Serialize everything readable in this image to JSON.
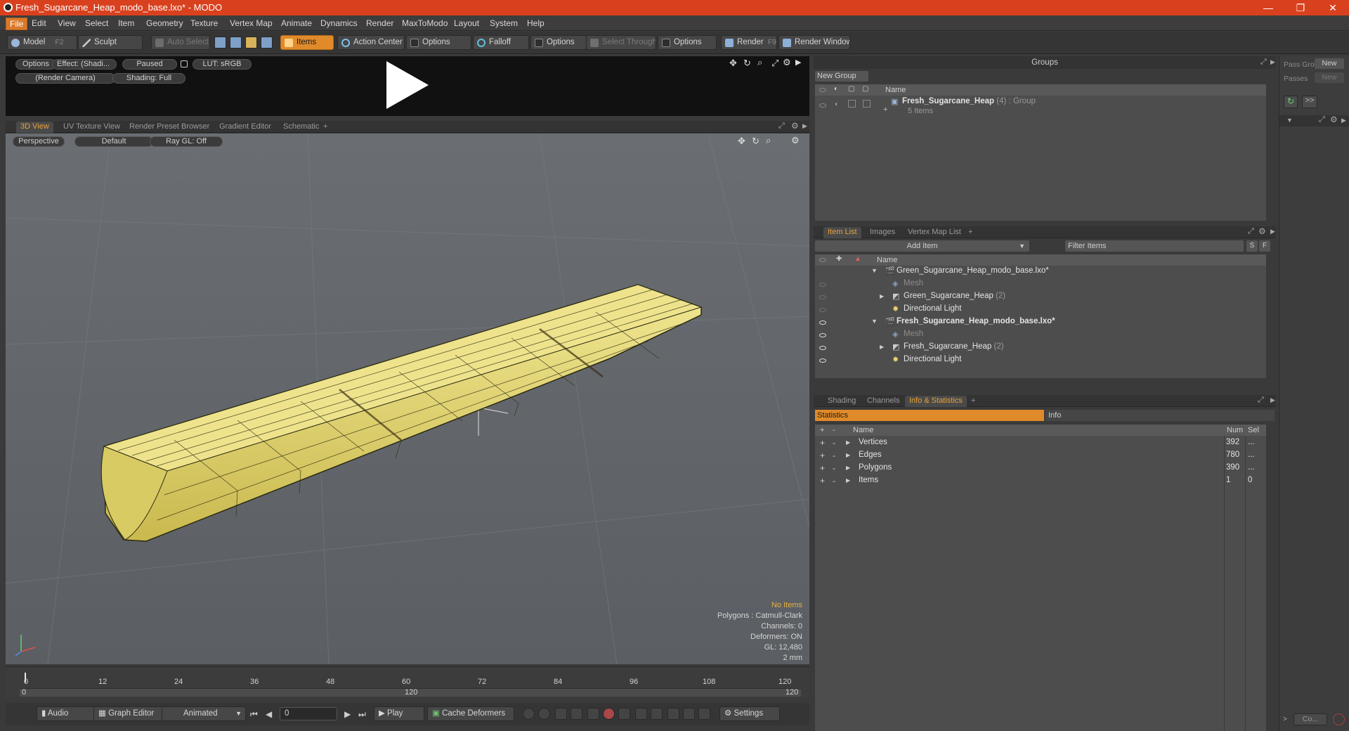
{
  "window": {
    "title": "Fresh_Sugarcane_Heap_modo_base.lxo* - MODO",
    "minimize": "—",
    "maximize": "❐",
    "close": "✕"
  },
  "menu": [
    "File",
    "Edit",
    "View",
    "Select",
    "Item",
    "Geometry",
    "Texture",
    "Vertex Map",
    "Animate",
    "Dynamics",
    "Render",
    "MaxToModo",
    "Layout",
    "System",
    "Help"
  ],
  "toolbar": {
    "model": "Model",
    "model_key": "F2",
    "sculpt": "Sculpt",
    "auto_select": "Auto Select",
    "items": "Items",
    "action_center": "Action Center",
    "options1": "Options",
    "falloff": "Falloff",
    "options2": "Options",
    "select_through": "Select Through",
    "options3": "Options",
    "render": "Render",
    "render_key": "F9",
    "render_window": "Render Window"
  },
  "preview": {
    "options": "Options",
    "effect": "Effect: (Shadi...",
    "paused": "Paused",
    "lut": "LUT: sRGB",
    "camera": "(Render Camera)",
    "shading": "Shading: Full"
  },
  "viewport_tabs": [
    "3D View",
    "UV Texture View",
    "Render Preset Browser",
    "Gradient Editor",
    "Schematic"
  ],
  "viewport": {
    "perspective": "Perspective",
    "default": "Default",
    "raygl": "Ray GL: Off",
    "stats": {
      "no_items": "No Items",
      "polygons": "Polygons : Catmull-Clark",
      "channels": "Channels: 0",
      "deformers": "Deformers: ON",
      "gl": "GL: 12,480",
      "scale": "2 mm"
    }
  },
  "timeline": {
    "ticks": [
      "0",
      "12",
      "24",
      "36",
      "48",
      "60",
      "72",
      "84",
      "96",
      "108",
      "120"
    ],
    "range_start": "0",
    "range_mid": "120",
    "range_end": "120"
  },
  "bottom": {
    "audio": "Audio",
    "graph_editor": "Graph Editor",
    "animated": "Animated",
    "frame": "0",
    "play": "Play",
    "cache_deformers": "Cache Deformers",
    "settings": "Settings"
  },
  "groups": {
    "title": "Groups",
    "new_group": "New Group",
    "col_name": "Name",
    "item_name": "Fresh_Sugarcane_Heap",
    "item_count": "(4)",
    "item_type": ": Group",
    "item_sub": "5 Items"
  },
  "pass": {
    "pass_groups": "Pass Gro",
    "new1": "New",
    "passes": "Passes",
    "new2": "New",
    "btn_more": ">>",
    "bottom_btn": "Co..."
  },
  "itemlist": {
    "tabs": [
      "Item List",
      "Images",
      "Vertex Map List"
    ],
    "add_item": "Add Item",
    "filter": "Filter Items",
    "s": "S",
    "f": "F",
    "col_name": "Name",
    "rows": [
      {
        "label": "Green_Sugarcane_Heap_modo_base.lxo*",
        "bold": false
      },
      {
        "label": "Mesh",
        "muted": true
      },
      {
        "label": "Green_Sugarcane_Heap",
        "count": "(2)"
      },
      {
        "label": "Directional Light"
      },
      {
        "label": "Fresh_Sugarcane_Heap_modo_base.lxo*",
        "bold": true
      },
      {
        "label": "Mesh",
        "muted": true
      },
      {
        "label": "Fresh_Sugarcane_Heap",
        "count": "(2)"
      },
      {
        "label": "Directional Light"
      }
    ]
  },
  "stats": {
    "tabs": [
      "Shading",
      "Channels",
      "Info & Statistics"
    ],
    "statistics": "Statistics",
    "info": "Info",
    "col_name": "Name",
    "col_num": "Num",
    "col_sel": "Sel",
    "rows": [
      {
        "name": "Vertices",
        "num": "392",
        "sel": "..."
      },
      {
        "name": "Edges",
        "num": "780",
        "sel": "..."
      },
      {
        "name": "Polygons",
        "num": "390",
        "sel": "..."
      },
      {
        "name": "Items",
        "num": "1",
        "sel": "0"
      }
    ]
  },
  "colors": {
    "accent": "#e08a2a",
    "titlebar": "#d9411e",
    "mesh": "#e8dd7a"
  }
}
